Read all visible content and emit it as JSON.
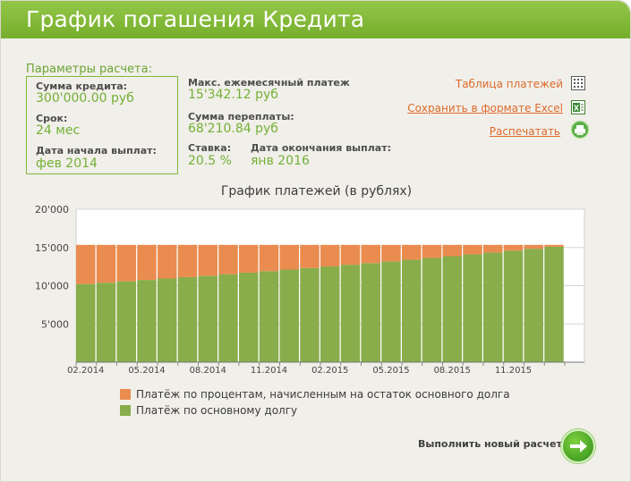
{
  "header": {
    "title": "График погашения Кредита"
  },
  "params": {
    "caption": "Параметры расчета:",
    "loan_amount": {
      "label": "Сумма кредита:",
      "value": "300'000.00 руб"
    },
    "term": {
      "label": "Срок:",
      "value": "24 мес"
    },
    "start_date": {
      "label": "Дата начала выплат:",
      "value": "фев 2014"
    }
  },
  "summary": {
    "max_payment": {
      "label": "Макс. ежемесячный платеж",
      "value": "15'342.12 руб"
    },
    "overpayment": {
      "label": "Сумма переплаты:",
      "value": "68'210.84 руб"
    },
    "rate": {
      "label": "Ставка:",
      "value": "20.5 %"
    },
    "end_date": {
      "label": "Дата окончания выплат:",
      "value": "янв 2016"
    }
  },
  "actions": {
    "table": "Таблица платежей",
    "excel": "Сохранить в формате Excel",
    "print": "Распечатать"
  },
  "chart_data": {
    "type": "bar",
    "stacked": true,
    "title": "График платежей (в рублях)",
    "xlabel": "",
    "ylabel": "",
    "ylim": [
      0,
      20000
    ],
    "yticks": [
      "5'000",
      "10'000",
      "15'000",
      "20'000"
    ],
    "ytick_values": [
      5000,
      10000,
      15000,
      20000
    ],
    "xtick_labels": [
      "02.2014",
      "05.2014",
      "08.2014",
      "11.2014",
      "02.2015",
      "05.2015",
      "08.2015",
      "11.2015"
    ],
    "categories": [
      "02.2014",
      "03.2014",
      "04.2014",
      "05.2014",
      "06.2014",
      "07.2014",
      "08.2014",
      "09.2014",
      "10.2014",
      "11.2014",
      "12.2014",
      "01.2015",
      "02.2015",
      "03.2015",
      "04.2015",
      "05.2015",
      "06.2015",
      "07.2015",
      "08.2015",
      "09.2015",
      "10.2015",
      "11.2015",
      "12.2015",
      "01.2016"
    ],
    "series": [
      {
        "name": "Платёж по основному долгу",
        "color": "#88ad4a",
        "values": [
          10217,
          10392,
          10570,
          10750,
          10934,
          11121,
          11311,
          11504,
          11701,
          11901,
          12104,
          12311,
          12521,
          12735,
          12953,
          13174,
          13399,
          13629,
          13861,
          14098,
          14339,
          14584,
          14833,
          15087
        ]
      },
      {
        "name": "Платёж по процентам, начисленным на остаток основного долга",
        "color": "#ea8c50",
        "values": [
          5125,
          4950,
          4772,
          4592,
          4408,
          4221,
          4031,
          3838,
          3641,
          3441,
          3238,
          3031,
          2821,
          2607,
          2389,
          2168,
          1943,
          1713,
          1481,
          1244,
          1003,
          758,
          509,
          255
        ]
      }
    ],
    "grid": true
  },
  "new_calc": {
    "label": "Выполнить новый расчет",
    "icon": "arrow-right-icon"
  }
}
